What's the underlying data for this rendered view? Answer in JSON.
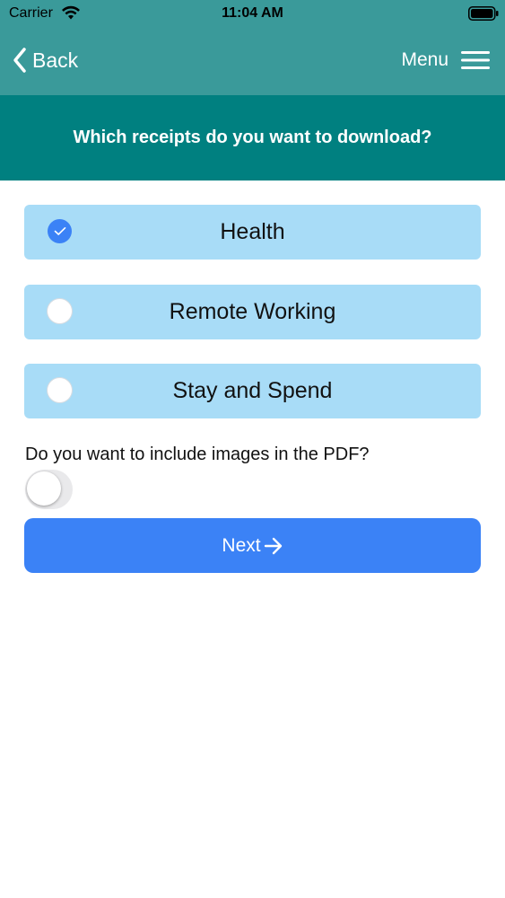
{
  "status_bar": {
    "carrier": "Carrier",
    "time": "11:04 AM"
  },
  "nav": {
    "back_label": "Back",
    "menu_label": "Menu"
  },
  "question": "Which receipts do you want to download?",
  "options": [
    {
      "label": "Health",
      "checked": true
    },
    {
      "label": "Remote Working",
      "checked": false
    },
    {
      "label": "Stay and Spend",
      "checked": false
    }
  ],
  "images_question": "Do you want to include images in the PDF?",
  "include_images": false,
  "next_label": "Next",
  "colors": {
    "nav_bg": "#3a9a9a",
    "banner_bg": "#008080",
    "option_bg": "#a8dcf7",
    "accent": "#3b82f6"
  },
  "icons": {
    "back": "chevron-left-icon",
    "menu": "hamburger-icon",
    "next": "arrow-right-icon",
    "check": "checkmark-icon"
  }
}
